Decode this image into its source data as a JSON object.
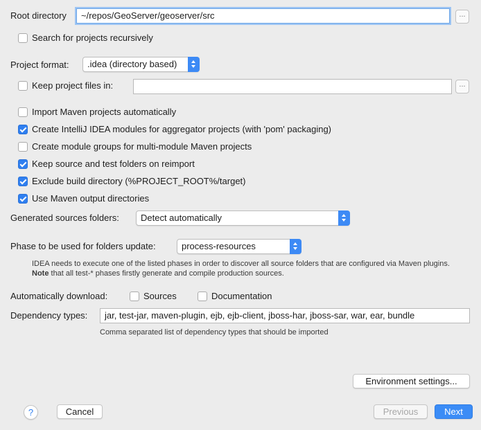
{
  "root_directory": {
    "label": "Root directory",
    "value": "~/repos/GeoServer/geoserver/src",
    "browse": "..."
  },
  "search_recursively": {
    "label": "Search for projects recursively",
    "checked": false
  },
  "project_format": {
    "label": "Project format:",
    "value": ".idea (directory based)"
  },
  "keep_project_files": {
    "label": "Keep project files in:",
    "value": "",
    "checked": false,
    "browse": "..."
  },
  "options": [
    {
      "label": "Import Maven projects automatically",
      "checked": false
    },
    {
      "label": "Create IntelliJ IDEA modules for aggregator projects (with 'pom' packaging)",
      "checked": true
    },
    {
      "label": "Create module groups for multi-module Maven projects",
      "checked": false
    },
    {
      "label": "Keep source and test folders on reimport",
      "checked": true
    },
    {
      "label": "Exclude build directory (%PROJECT_ROOT%/target)",
      "checked": true
    },
    {
      "label": "Use Maven output directories",
      "checked": true
    }
  ],
  "generated_sources": {
    "label": "Generated sources folders:",
    "value": "Detect automatically"
  },
  "phase": {
    "label": "Phase to be used for folders update:",
    "value": "process-resources",
    "note_line1": "IDEA needs to execute one of the listed phases in order to discover all source folders that are configured via Maven plugins.",
    "note_bold": "Note",
    "note_line2_rest": " that all test-* phases firstly generate and compile production sources."
  },
  "auto_download": {
    "label": "Automatically download:",
    "sources_label": "Sources",
    "sources_checked": false,
    "documentation_label": "Documentation",
    "documentation_checked": false
  },
  "dependency_types": {
    "label": "Dependency types:",
    "value": "jar, test-jar, maven-plugin, ejb, ejb-client, jboss-har, jboss-sar, war, ear, bundle",
    "hint": "Comma separated list of dependency types that should be imported"
  },
  "buttons": {
    "environment": "Environment settings...",
    "help": "?",
    "cancel": "Cancel",
    "previous": "Previous",
    "next": "Next"
  },
  "colors": {
    "accent": "#2f7ff0",
    "background": "#ececec",
    "focus_ring": "#9cc4f3"
  }
}
